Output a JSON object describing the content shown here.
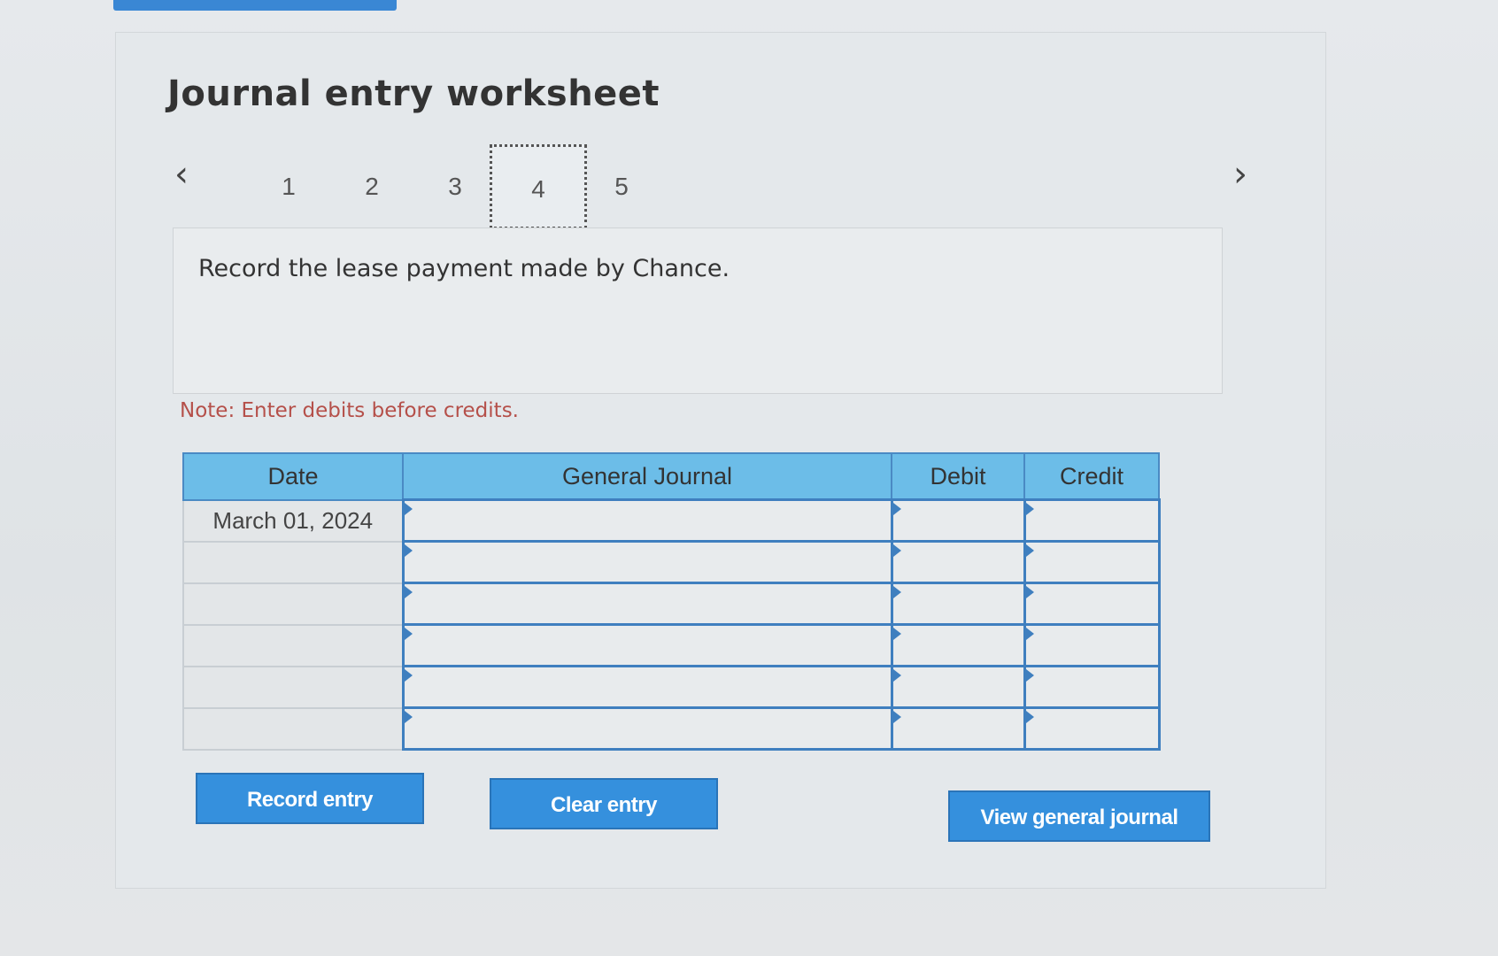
{
  "worksheet": {
    "title": "Journal entry worksheet",
    "steps": [
      "1",
      "2",
      "3",
      "4",
      "5"
    ],
    "active_step": "4",
    "prompt": "Record the lease payment made by Chance.",
    "note": "Note: Enter debits before credits."
  },
  "journal": {
    "headers": {
      "date": "Date",
      "general_journal": "General Journal",
      "debit": "Debit",
      "credit": "Credit"
    },
    "rows": [
      {
        "date": "March 01, 2024",
        "account": "",
        "debit": "",
        "credit": ""
      },
      {
        "date": "",
        "account": "",
        "debit": "",
        "credit": ""
      },
      {
        "date": "",
        "account": "",
        "debit": "",
        "credit": ""
      },
      {
        "date": "",
        "account": "",
        "debit": "",
        "credit": ""
      },
      {
        "date": "",
        "account": "",
        "debit": "",
        "credit": ""
      },
      {
        "date": "",
        "account": "",
        "debit": "",
        "credit": ""
      }
    ]
  },
  "buttons": {
    "record": "Record entry",
    "clear": "Clear entry",
    "view": "View general journal"
  },
  "icons": {
    "prev": "chevron-left-icon",
    "next": "chevron-right-icon"
  },
  "colors": {
    "accent": "#3590dd",
    "header_bg": "#6cbde8",
    "note": "#b5504a"
  }
}
